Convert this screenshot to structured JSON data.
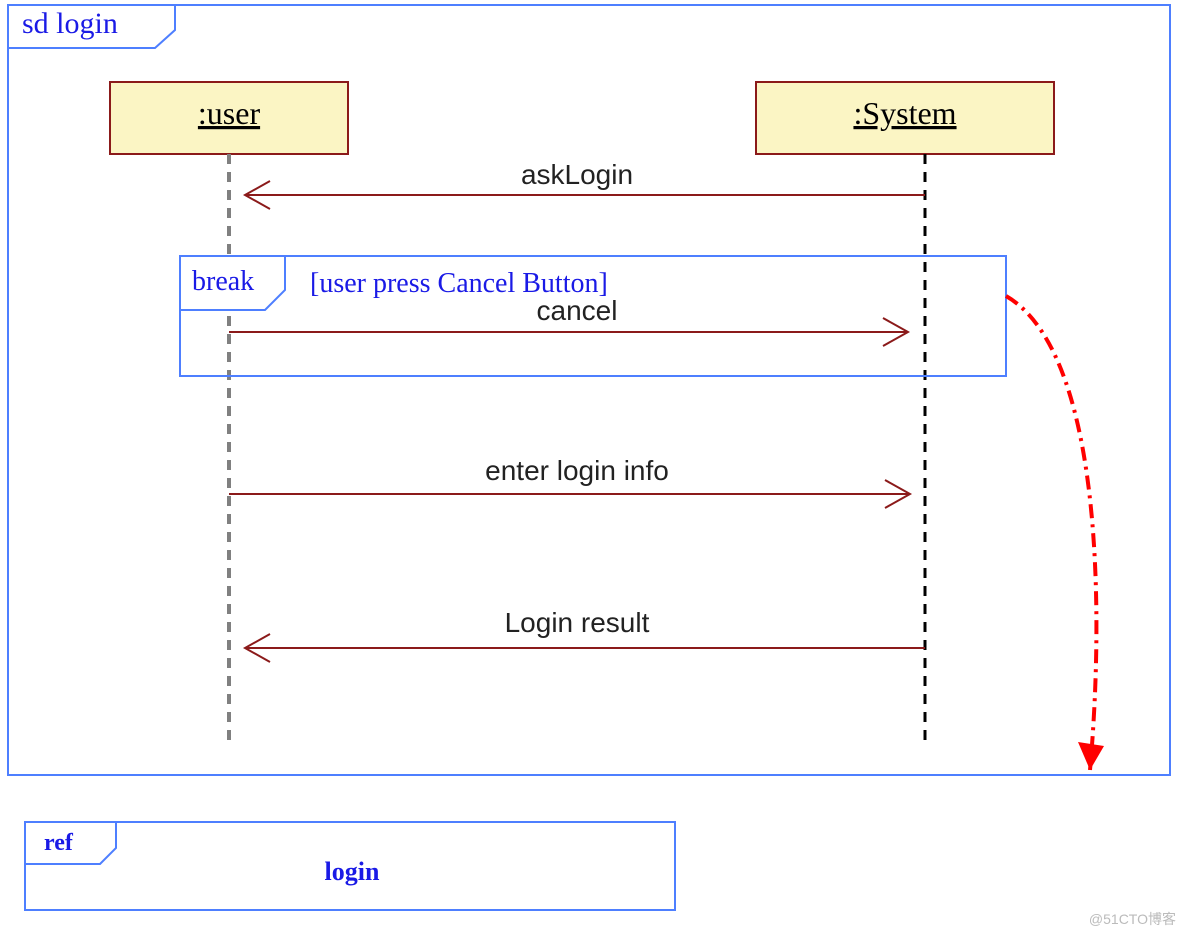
{
  "frame": {
    "title": "sd login"
  },
  "lifelines": {
    "user": {
      "label": ":user"
    },
    "system": {
      "label": ":System"
    }
  },
  "messages": {
    "askLogin": {
      "label": "askLogin"
    },
    "cancel": {
      "label": "cancel"
    },
    "enterLoginInfo": {
      "label": "enter login info"
    },
    "loginResult": {
      "label": "Login result"
    }
  },
  "fragment": {
    "operator": "break",
    "guard": "[user press Cancel Button]"
  },
  "ref": {
    "operator": "ref",
    "label": "login"
  },
  "watermark": "@51CTO博客",
  "colors": {
    "frameBorder": "#4e7fff",
    "lifelineFill": "#fbf5c4",
    "lifelineStroke": "#8b1a1a",
    "messageLine": "#8b1a1a",
    "userLifelineDash": "#808080",
    "systemLifelineDash": "#000000",
    "breakArrow": "#ff0000"
  }
}
